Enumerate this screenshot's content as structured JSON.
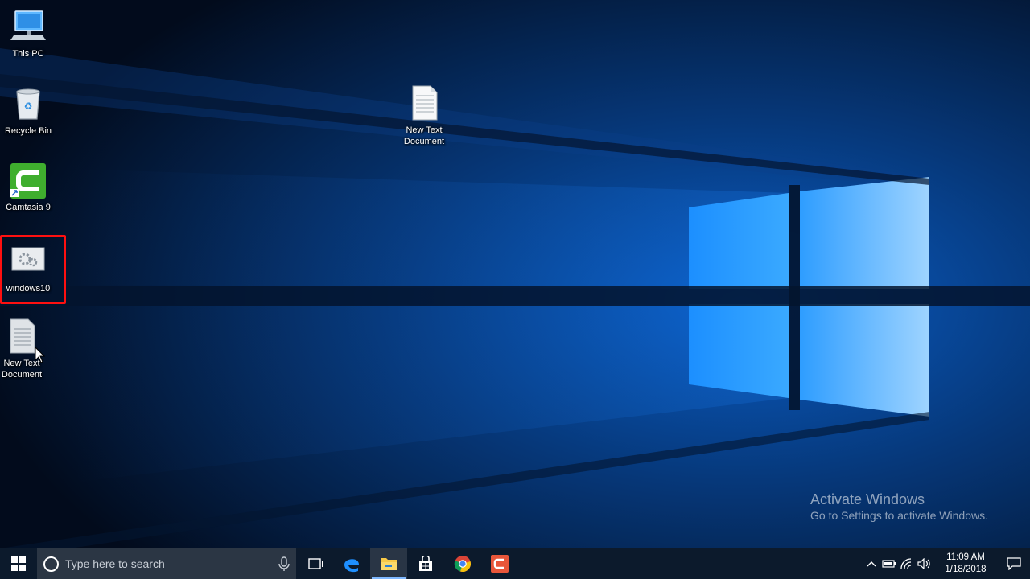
{
  "desktop": {
    "icons": [
      {
        "label": "This PC"
      },
      {
        "label": "Recycle Bin"
      },
      {
        "label": "Camtasia 9"
      },
      {
        "label": "windows10"
      },
      {
        "label": "New Text\nDocument"
      },
      {
        "label": "New Text\nDocument"
      }
    ],
    "highlighted_icon": "windows10",
    "highlight_color": "#ff1010"
  },
  "watermark": {
    "title": "Activate Windows",
    "subtitle": "Go to Settings to activate Windows."
  },
  "taskbar": {
    "search_placeholder": "Type here to search",
    "pinned": [
      "start-icon",
      "task-view-icon",
      "edge-icon",
      "file-explorer-icon",
      "store-icon",
      "chrome-icon",
      "camtasia-icon"
    ],
    "active_app": "file-explorer-icon",
    "clock": {
      "time": "11:09 AM",
      "date": "1/18/2018"
    }
  },
  "colors": {
    "accent": "#1e90ff",
    "taskbar": "#0c1a2c"
  }
}
